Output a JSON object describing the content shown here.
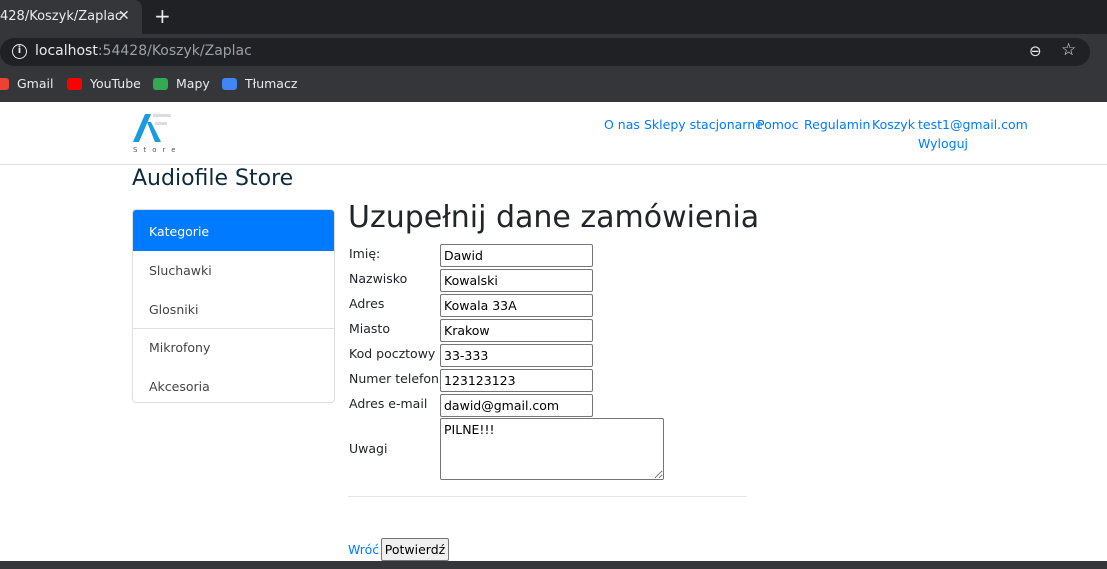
{
  "browser": {
    "tab_title": "428/Koszyk/Zaplac",
    "url_host": "localhost",
    "url_path": ":54428/Koszyk/Zaplac",
    "bookmarks": [
      {
        "label": "Gmail",
        "color": "#ea4335"
      },
      {
        "label": "YouTube",
        "color": "#ff0000"
      },
      {
        "label": "Mapy",
        "color": "#34a853"
      },
      {
        "label": "Tłumacz",
        "color": "#4285f4"
      }
    ]
  },
  "nav": {
    "logo_text": "Store",
    "links": [
      "O nas",
      "Sklepy stacjonarne",
      "Pomoc",
      "Regulamin",
      "Koszyk",
      "test1@gmail.com"
    ],
    "logout": "Wyloguj"
  },
  "brand": "Audiofile Store",
  "sidebar": {
    "items": [
      "Kategorie",
      "Sluchawki",
      "Glosniki",
      "Mikrofony",
      "Akcesoria"
    ]
  },
  "form": {
    "title": "Uzupełnij dane zamówienia",
    "fields": [
      {
        "label": "Imię:",
        "value": "Dawid"
      },
      {
        "label": "Nazwisko",
        "value": "Kowalski"
      },
      {
        "label": "Adres",
        "value": "Kowala 33A"
      },
      {
        "label": "Miasto",
        "value": "Krakow"
      },
      {
        "label": "Kod pocztowy",
        "value": "33-333"
      },
      {
        "label": "Numer telefonu",
        "value": "123123123"
      },
      {
        "label": "Adres e-mail",
        "value": "dawid@gmail.com"
      }
    ],
    "notes_label": "Uwagi",
    "notes_value": "PILNE!!!",
    "back": "Wróć",
    "confirm": "Potwierdź"
  },
  "colors": {
    "accent": "#007bff"
  }
}
